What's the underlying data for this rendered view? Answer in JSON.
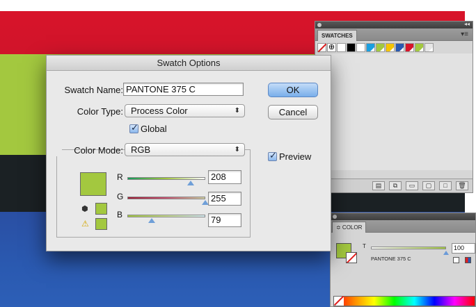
{
  "dialog": {
    "title": "Swatch Options",
    "swatch_name_label": "Swatch Name:",
    "swatch_name_value": "PANTONE 375 C",
    "color_type_label": "Color Type:",
    "color_type_value": "Process Color",
    "global_label": "Global",
    "global_checked": true,
    "color_mode_label": "Color Mode:",
    "color_mode_value": "RGB",
    "preview_label": "Preview",
    "preview_checked": true,
    "ok_label": "OK",
    "cancel_label": "Cancel",
    "swatch_color": "#a3c83f",
    "channels": [
      {
        "label": "R",
        "value": "208",
        "fraction": 0.816
      },
      {
        "label": "G",
        "value": "255",
        "fraction": 1.0
      },
      {
        "label": "B",
        "value": "79",
        "fraction": 0.31
      }
    ],
    "select_arrows": "⬍"
  },
  "swatches_panel": {
    "tab_label": "SWATCHES",
    "collapse_glyph": "◂◂",
    "menu_glyph": "▾≡",
    "swatches": [
      {
        "kind": "none",
        "color": "#ffffff"
      },
      {
        "kind": "registration",
        "color": "#ffffff",
        "glyph": "⊕"
      },
      {
        "kind": "plain",
        "color": "#ffffff"
      },
      {
        "kind": "plain",
        "color": "#000000"
      },
      {
        "kind": "plain",
        "color": "#ffffff"
      },
      {
        "kind": "global",
        "color": "#1a9fe0"
      },
      {
        "kind": "global",
        "color": "#a3c83f"
      },
      {
        "kind": "global",
        "color": "#f5c400"
      },
      {
        "kind": "global",
        "color": "#2a59b0"
      },
      {
        "kind": "global",
        "color": "#d8142a"
      },
      {
        "kind": "global",
        "color": "#a3c83f"
      },
      {
        "kind": "global",
        "color": "#e6e6e6"
      }
    ],
    "footer_buttons": [
      "▤",
      "⧉",
      "▭",
      "▢",
      "□",
      "🗑"
    ]
  },
  "color_panel": {
    "tab_label": "≎ COLOR",
    "tint_label": "T",
    "tint_value": "100",
    "tint_fraction": 1.0,
    "swatch_name": "PANTONE 375 C",
    "fill_color": "#a3c83f"
  },
  "artwork": {
    "band_colors": [
      "#d8142a",
      "#a3c83f",
      "#1b2124",
      "#2a59b0"
    ]
  }
}
